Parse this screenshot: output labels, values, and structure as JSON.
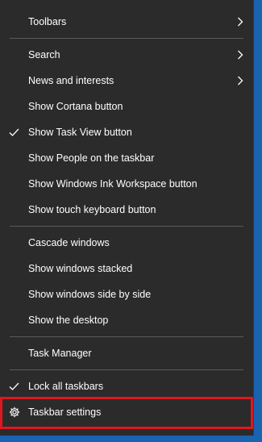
{
  "menu": {
    "toolbars": "Toolbars",
    "search": "Search",
    "news": "News and interests",
    "cortana": "Show Cortana button",
    "task_view": "Show Task View button",
    "people": "Show People on the taskbar",
    "ink": "Show Windows Ink Workspace button",
    "touch_keyboard": "Show touch keyboard button",
    "cascade": "Cascade windows",
    "stacked": "Show windows stacked",
    "side_by_side": "Show windows side by side",
    "desktop": "Show the desktop",
    "task_manager": "Task Manager",
    "lock": "Lock all taskbars",
    "settings": "Taskbar settings"
  },
  "icons": {
    "submenu": "chevron-right-icon",
    "check": "checkmark-icon",
    "settings": "gear-icon"
  },
  "colors": {
    "menu_background": "#2b2b2b",
    "text": "#ffffff",
    "separator": "#5a5a5a",
    "highlight_border": "#e0161e",
    "desktop_background": "#1a63b0"
  }
}
